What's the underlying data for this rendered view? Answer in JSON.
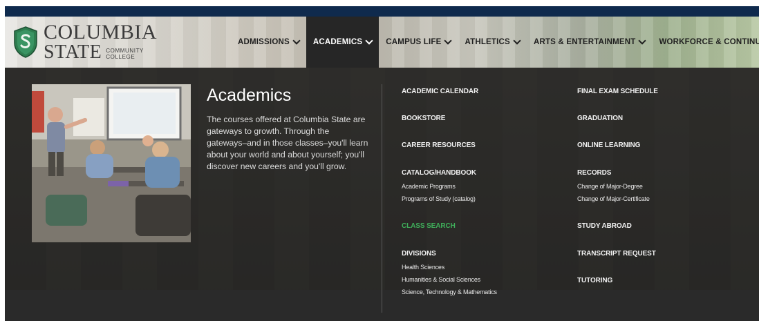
{
  "logo": {
    "line1": "COLUMBIA",
    "line2": "STATE",
    "line3a": "COMMUNITY",
    "line3b": "COLLEGE"
  },
  "nav": [
    {
      "label": "ADMISSIONS"
    },
    {
      "label": "ACADEMICS"
    },
    {
      "label": "CAMPUS LIFE"
    },
    {
      "label": "ATHLETICS"
    },
    {
      "label": "ARTS & ENTERTAINMENT"
    },
    {
      "label": "WORKFORCE & CONTINUING EDU"
    }
  ],
  "dropdown": {
    "title": "Academics",
    "description": "The courses offered at Columbia State are gateways to growth. Through the gateways–and in those classes–you'll learn about your world and about yourself; you'll discover new careers and you'll grow.",
    "col1": {
      "academic_calendar": "ACADEMIC CALENDAR",
      "bookstore": "BOOKSTORE",
      "career_resources": "CAREER RESOURCES",
      "catalog_handbook": "CATALOG/HANDBOOK",
      "academic_programs": "Academic Programs",
      "programs_of_study": "Programs of Study (catalog)",
      "class_search": "CLASS SEARCH",
      "divisions": "DIVISIONS",
      "health_sciences": "Health Sciences",
      "humanities": "Humanities & Social Sciences",
      "stem": "Science, Technology & Mathematics"
    },
    "col2": {
      "final_exam": "FINAL EXAM SCHEDULE",
      "graduation": "GRADUATION",
      "online_learning": "ONLINE LEARNING",
      "records": "RECORDS",
      "change_degree": "Change of Major-Degree",
      "change_certificate": "Change of Major-Certificate",
      "study_abroad": "STUDY ABROAD",
      "transcript_request": "TRANSCRIPT REQUEST",
      "tutoring": "TUTORING"
    }
  },
  "colors": {
    "top_strip": "#0f2a4d",
    "dropdown_bg": "#242424",
    "class_search": "#3fae5a",
    "logo_green": "#2e7d4f"
  }
}
